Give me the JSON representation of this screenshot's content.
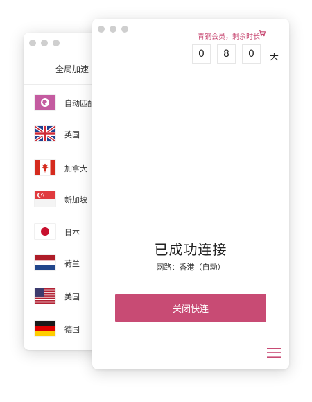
{
  "sidebar": {
    "title": "全局加速",
    "regions": [
      {
        "label": "自动匹配",
        "flag": "globe-icon"
      },
      {
        "label": "英国",
        "flag": "uk-flag"
      },
      {
        "label": "加拿大",
        "flag": "canada-flag"
      },
      {
        "label": "新加坡",
        "flag": "singapore-flag"
      },
      {
        "label": "日本",
        "flag": "japan-flag"
      },
      {
        "label": "荷兰",
        "flag": "netherlands-flag"
      },
      {
        "label": "美国",
        "flag": "usa-flag"
      },
      {
        "label": "德国",
        "flag": "germany-flag"
      }
    ]
  },
  "main": {
    "member_link": "青铜会员，剩余时长",
    "days_digits": [
      "0",
      "8",
      "0"
    ],
    "days_unit": "天",
    "status": "已成功连接",
    "network": "网路：香港（自动）",
    "disconnect_label": "关闭快连"
  },
  "colors": {
    "accent": "#c84b74"
  }
}
